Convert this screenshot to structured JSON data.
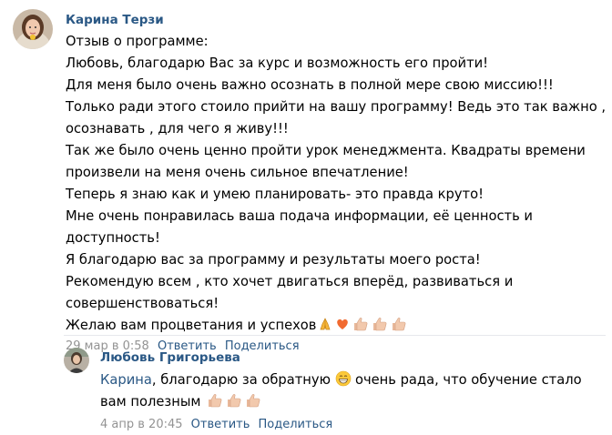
{
  "comment": {
    "author": "Карина Терзи",
    "lines": [
      "Отзыв о программе:",
      "Любовь, благодарю Вас за курс и возможность его пройти!",
      "Для меня было очень важно осознать в полной мере свою миссию!!!",
      "Только ради этого стоило прийти на вашу программу! Ведь это так важно ,",
      "осознавать , для чего я живу!!!",
      "Так же было очень ценно пройти урок менеджмента. Квадраты времени",
      "произвели на меня очень сильное впечатление!",
      "Теперь я знаю как и умею планировать- это правда круто!",
      "Мне очень понравилась ваша подача информации, её ценность и",
      "доступность!",
      "Я благодарю вас за программу и результаты моего роста!",
      "Рекомендую всем , кто хочет двигаться вперёд, развиваться и",
      "совершенствоваться!"
    ],
    "last_line": "Желаю вам процветания и успехов",
    "last_line_emojis": [
      "folded-hands-icon",
      "orange-heart-icon",
      "thumbs-up-icon",
      "thumbs-up-icon",
      "thumbs-up-icon"
    ],
    "timestamp": "29 мар в 0:58",
    "reply_label": "Ответить",
    "share_label": "Поделиться"
  },
  "reply": {
    "author": "Любовь Григорьева",
    "mention": "Карина",
    "text_part1": ", благодарю за обратную",
    "text_part2": "очень рада, что обучение стало",
    "line2": "вам полезным",
    "emojis_line1": [
      "grinning-face-icon"
    ],
    "emojis_line2": [
      "thumbs-up-icon",
      "thumbs-up-icon",
      "thumbs-up-icon"
    ],
    "timestamp": "4 апр в 20:45",
    "reply_label": "Ответить",
    "share_label": "Поделиться"
  },
  "colors": {
    "link": "#2a5885",
    "meta": "#939393",
    "divider": "#e7e8ec"
  }
}
